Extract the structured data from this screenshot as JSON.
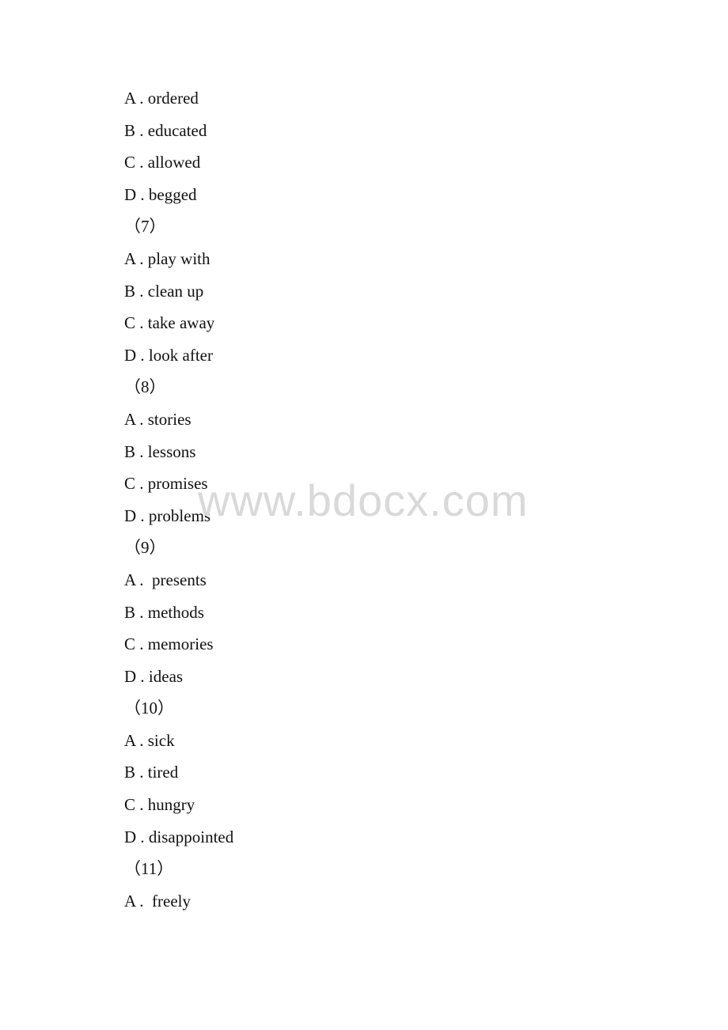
{
  "document": {
    "lines": [
      {
        "type": "option",
        "text": "A . ordered"
      },
      {
        "type": "option",
        "text": "B . educated"
      },
      {
        "type": "option",
        "text": "C . allowed"
      },
      {
        "type": "option",
        "text": "D . begged"
      },
      {
        "type": "question-number",
        "text": "（7）"
      },
      {
        "type": "option",
        "text": "A . play with"
      },
      {
        "type": "option",
        "text": "B . clean up"
      },
      {
        "type": "option",
        "text": "C . take away"
      },
      {
        "type": "option",
        "text": "D . look after"
      },
      {
        "type": "question-number",
        "text": "（8）"
      },
      {
        "type": "option",
        "text": "A . stories"
      },
      {
        "type": "option",
        "text": "B . lessons"
      },
      {
        "type": "option",
        "text": "C . promises"
      },
      {
        "type": "option",
        "text": "D . problems"
      },
      {
        "type": "question-number",
        "text": "（9）"
      },
      {
        "type": "option",
        "text": "A .  presents"
      },
      {
        "type": "option",
        "text": "B . methods"
      },
      {
        "type": "option",
        "text": "C . memories"
      },
      {
        "type": "option",
        "text": "D . ideas"
      },
      {
        "type": "question-number",
        "text": "（10）"
      },
      {
        "type": "option",
        "text": "A . sick"
      },
      {
        "type": "option",
        "text": "B . tired"
      },
      {
        "type": "option",
        "text": "C . hungry"
      },
      {
        "type": "option",
        "text": "D . disappointed"
      },
      {
        "type": "question-number",
        "text": "（11）"
      },
      {
        "type": "option",
        "text": "A .  freely"
      }
    ],
    "watermark": "www.bdocx.com"
  }
}
